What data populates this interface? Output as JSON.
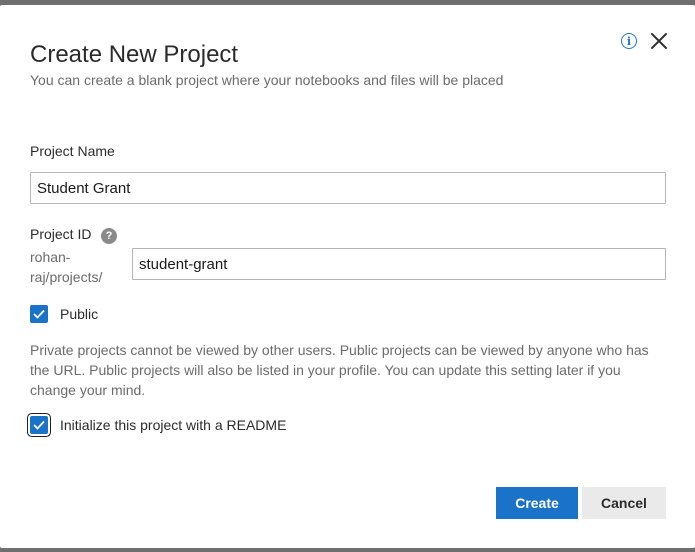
{
  "dialog": {
    "title": "Create New Project",
    "subtitle": "You can create a blank project where your notebooks and files will be placed",
    "icons": {
      "info": "info-icon",
      "close": "close-icon"
    }
  },
  "form": {
    "project_name_label": "Project Name",
    "project_name_value": "Student Grant",
    "project_id_label": "Project ID",
    "project_id_help": "?",
    "project_id_prefix_line1": "rohan-",
    "project_id_prefix_line2": "raj/projects/",
    "project_id_value": "student-grant",
    "public_label": "Public",
    "public_checked": true,
    "public_description": "Private projects cannot be viewed by other users. Public projects can be viewed by anyone who has the URL. Public projects will also be listed in your profile. You can update this setting later if you change your mind.",
    "readme_label": "Initialize this project with a README",
    "readme_checked": true
  },
  "actions": {
    "create_label": "Create",
    "cancel_label": "Cancel"
  },
  "colors": {
    "accent": "#1a73c8",
    "backdrop": "#6f6f6f"
  }
}
